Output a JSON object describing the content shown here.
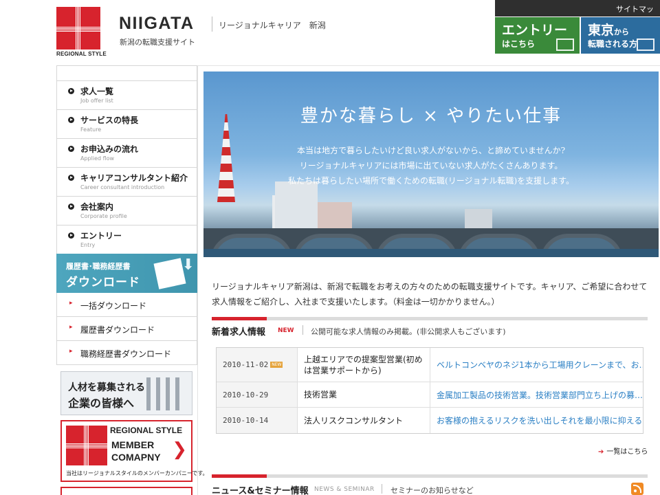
{
  "header": {
    "logo_caption": "REGIONAL STYLE",
    "brand_title": "NIIGATA",
    "brand_subtitle": "新潟の転職支援サイト",
    "brand_regional": "リージョナルキャリア　新潟",
    "sitemap_label": "サイトマップ",
    "entry_button": {
      "big": "エントリー",
      "small": "はこちら"
    },
    "tokyo_button": {
      "big": "東京",
      "suffix": "から",
      "small": "転職される方"
    }
  },
  "sidebar": {
    "nav": [
      {
        "jp": "求人一覧",
        "en": "Job offer list"
      },
      {
        "jp": "サービスの特長",
        "en": "Feature"
      },
      {
        "jp": "お申込みの流れ",
        "en": "Applied flow"
      },
      {
        "jp": "キャリアコンサルタント紹介",
        "en": "Career consultant introduction"
      },
      {
        "jp": "会社案内",
        "en": "Corporate profile"
      },
      {
        "jp": "エントリー",
        "en": "Entry"
      }
    ],
    "download_banner": {
      "line1": "履歴書･職務経歴書",
      "line2": "ダウンロード"
    },
    "downloads": [
      {
        "label": "一括ダウンロード"
      },
      {
        "label": "履歴書ダウンロード"
      },
      {
        "label": "職務経歴書ダウンロード"
      }
    ],
    "recruit_banner": {
      "line1": "人材を募集される",
      "line2": "企業の皆様へ"
    },
    "member_banner": {
      "line1": "REGIONAL STYLE",
      "line2": "MEMBER",
      "line3": "COMAPNY",
      "note": "当社はリージョナルスタイルのメンバーカンパニーです。"
    }
  },
  "hero": {
    "headline": "豊かな暮らし × やりたい仕事",
    "lines": [
      "本当は地方で暮らしたいけど良い求人がないから、と諦めていませんか?",
      "リージョナルキャリアには市場に出ていない求人がたくさんあります。",
      "私たちは暮らしたい場所で働くための転職(リージョナル転職)を支援します。"
    ]
  },
  "intro": "リージョナルキャリア新潟は、新潟で転職をお考えの方々のための転職支援サイトです。キャリア、ご希望に合わせて求人情報をご紹介し、入社まで支援いたします。（料金は一切かかりません。）",
  "jobs_section": {
    "title": "新着求人情報",
    "new_badge": "NEW",
    "note": "公開可能な求人情報のみ掲載。(非公開求人もございます)",
    "rows": [
      {
        "date": "2010-11-02",
        "badge": "NEW",
        "title": "上越エリアでの提案型営業(初めは営業サポートから)",
        "desc": "ベルトコンベヤのネジ1本から工場用クレーンまで、お…"
      },
      {
        "date": "2010-10-29",
        "badge": "",
        "title": "技術営業",
        "desc": "金属加工製品の技術営業。技術営業部門立ち上げの募…"
      },
      {
        "date": "2010-10-14",
        "badge": "",
        "title": "法人リスクコンサルタント",
        "desc": "お客様の抱えるリスクを洗い出しそれを最小限に抑える…"
      }
    ],
    "more_link": "一覧はこちら"
  },
  "news_section": {
    "title": "ニュース&セミナー情報",
    "en": "NEWS & SEMINAR",
    "note": "セミナーのお知らせなど"
  },
  "colors": {
    "brand_red": "#d7232d",
    "entry_green": "#3a8a3a",
    "tokyo_blue": "#2c6c9e",
    "link_blue": "#2a7fc4",
    "download_teal": "#4ea6be"
  },
  "icons": [
    "nav-bullet-icon",
    "download-arrow-icon",
    "rss-icon",
    "new-icon",
    "arrow-right-icon"
  ]
}
